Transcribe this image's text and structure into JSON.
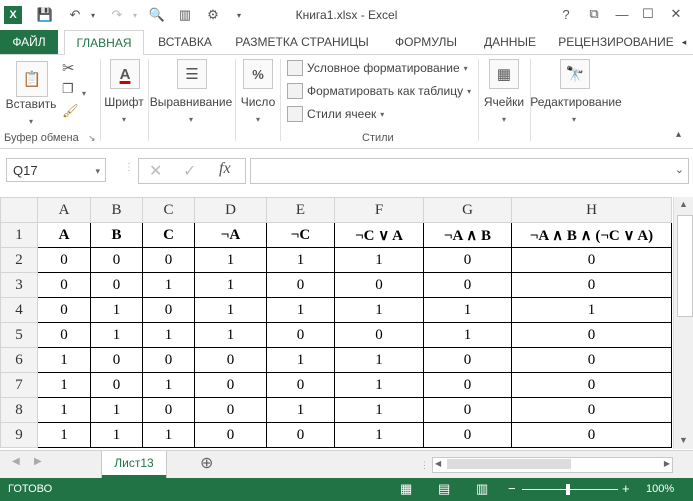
{
  "window": {
    "title": "Книга1.xlsx - Excel",
    "help": "?"
  },
  "tabs": {
    "file": "ФАЙЛ",
    "home": "ГЛАВНАЯ",
    "insert": "ВСТАВКА",
    "layout": "РАЗМЕТКА СТРАНИЦЫ",
    "formulas": "ФОРМУЛЫ",
    "data": "ДАННЫЕ",
    "review": "РЕЦЕНЗИРОВАНИЕ"
  },
  "ribbon": {
    "paste": "Вставить",
    "clipboard_group": "Буфер обмена",
    "font": "Шрифт",
    "alignment": "Выравнивание",
    "number": "Число",
    "conditional": "Условное форматирование",
    "format_table": "Форматировать как таблицу",
    "cell_styles": "Стили ячеек",
    "styles_group": "Стили",
    "cells": "Ячейки",
    "editing": "Редактирование"
  },
  "formula_bar": {
    "name_box": "Q17",
    "fx": "fx",
    "formula": ""
  },
  "sheet": {
    "columns": [
      "A",
      "B",
      "C",
      "D",
      "E",
      "F",
      "G",
      "H"
    ],
    "rows": [
      {
        "num": "1",
        "cells": [
          "A",
          "B",
          "C",
          "¬A",
          "¬C",
          "¬C ∨ A",
          "¬A ∧ B",
          "¬A ∧ B ∧ (¬C ∨ A)"
        ]
      },
      {
        "num": "2",
        "cells": [
          "0",
          "0",
          "0",
          "1",
          "1",
          "1",
          "0",
          "0"
        ]
      },
      {
        "num": "3",
        "cells": [
          "0",
          "0",
          "1",
          "1",
          "0",
          "0",
          "0",
          "0"
        ]
      },
      {
        "num": "4",
        "cells": [
          "0",
          "1",
          "0",
          "1",
          "1",
          "1",
          "1",
          "1"
        ]
      },
      {
        "num": "5",
        "cells": [
          "0",
          "1",
          "1",
          "1",
          "0",
          "0",
          "1",
          "0"
        ]
      },
      {
        "num": "6",
        "cells": [
          "1",
          "0",
          "0",
          "0",
          "1",
          "1",
          "0",
          "0"
        ]
      },
      {
        "num": "7",
        "cells": [
          "1",
          "0",
          "1",
          "0",
          "0",
          "1",
          "0",
          "0"
        ]
      },
      {
        "num": "8",
        "cells": [
          "1",
          "1",
          "0",
          "0",
          "1",
          "1",
          "0",
          "0"
        ]
      },
      {
        "num": "9",
        "cells": [
          "1",
          "1",
          "1",
          "0",
          "0",
          "1",
          "0",
          "0"
        ]
      }
    ]
  },
  "sheet_tabs": {
    "active": "Лист13",
    "add": "⊕"
  },
  "status": {
    "ready": "ГОТОВО",
    "zoom": "100%"
  },
  "colors": {
    "accent": "#217346"
  }
}
